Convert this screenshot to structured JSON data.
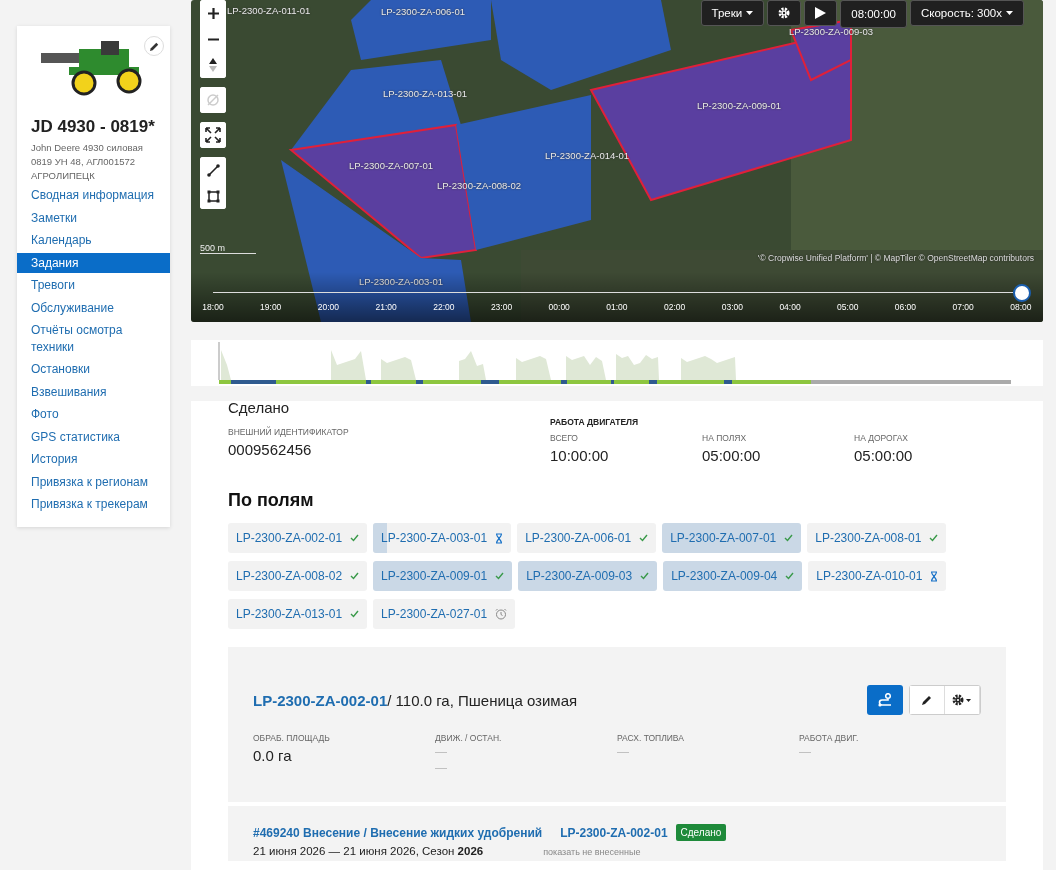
{
  "vehicle": {
    "name": "JD 4930 - 0819*",
    "description": "John Deere 4930 силовая 0819 УН 48, АГЛ001572 АГРОЛИПЕЦК"
  },
  "sidebar": {
    "items": [
      {
        "label": "Сводная информация",
        "selected": false
      },
      {
        "label": "Заметки",
        "selected": false
      },
      {
        "label": "Календарь",
        "selected": false
      },
      {
        "label": "Задания",
        "selected": true
      },
      {
        "label": "Тревоги",
        "selected": false
      },
      {
        "label": "Обслуживание",
        "selected": false
      },
      {
        "label": "Отчёты осмотра техники",
        "selected": false
      },
      {
        "label": "Остановки",
        "selected": false
      },
      {
        "label": "Взвешивания",
        "selected": false
      },
      {
        "label": "Фото",
        "selected": false
      },
      {
        "label": "GPS статистика",
        "selected": false
      },
      {
        "label": "История",
        "selected": false
      },
      {
        "label": "Привязка к регионам",
        "selected": false
      },
      {
        "label": "Привязка к трекерам",
        "selected": false
      }
    ]
  },
  "map": {
    "toolbar": {
      "tracks": "Треки",
      "time": "08:00:00",
      "speed": "Скорость: 300x"
    },
    "field_labels": [
      {
        "text": "LP-2300-ZA-011-01"
      },
      {
        "text": "LP-2300-ZA-006-01"
      },
      {
        "text": "LP-2300-ZA-009-03"
      },
      {
        "text": "LP-2300-ZA-013-01"
      },
      {
        "text": "LP-2300-ZA-009-01"
      },
      {
        "text": "LP-2300-ZA-014-01"
      },
      {
        "text": "LP-2300-ZA-007-01"
      },
      {
        "text": "LP-2300-ZA-008-02"
      },
      {
        "text": "LP-2300-ZA-003-01"
      }
    ],
    "scale": "500 m",
    "attribution": "'© Cropwise Unified Platform' | © MapTiler © OpenStreetMap contributors",
    "timeline": {
      "level": 1,
      "ticks": [
        "18:00",
        "19:00",
        "20:00",
        "21:00",
        "22:00",
        "23:00",
        "00:00",
        "01:00",
        "02:00",
        "03:00",
        "04:00",
        "05:00",
        "06:00",
        "07:00",
        "08:00"
      ]
    }
  },
  "summary": {
    "status": "Сделано",
    "external_id_label": "ВНЕШНИЙ ИДЕНТИФИКАТОР",
    "external_id": "0009562456",
    "engine_title": "РАБОТА ДВИГАТЕЛЯ",
    "engine": [
      {
        "label": "ВСЕГО",
        "value": "10:00:00"
      },
      {
        "label": "НА ПОЛЯХ",
        "value": "05:00:00"
      },
      {
        "label": "НА ДОРОГАХ",
        "value": "05:00:00"
      }
    ]
  },
  "fields": {
    "title": "По полям",
    "chips": [
      {
        "label": "LP-2300-ZA-002-01",
        "kind": "done",
        "highlighted": false
      },
      {
        "label": "LP-2300-ZA-003-01",
        "kind": "pending",
        "highlighted": false,
        "level": 0.1
      },
      {
        "label": "LP-2300-ZA-006-01",
        "kind": "done",
        "highlighted": false
      },
      {
        "label": "LP-2300-ZA-007-01",
        "kind": "done",
        "highlighted": true
      },
      {
        "label": "LP-2300-ZA-008-01",
        "kind": "done",
        "highlighted": false
      },
      {
        "label": "LP-2300-ZA-008-02",
        "kind": "done",
        "highlighted": false
      },
      {
        "label": "LP-2300-ZA-009-01",
        "kind": "done",
        "highlighted": true
      },
      {
        "label": "LP-2300-ZA-009-03",
        "kind": "done",
        "highlighted": true
      },
      {
        "label": "LP-2300-ZA-009-04",
        "kind": "done",
        "highlighted": true
      },
      {
        "label": "LP-2300-ZA-010-01",
        "kind": "pending",
        "highlighted": false
      },
      {
        "label": "LP-2300-ZA-013-01",
        "kind": "done",
        "highlighted": false
      },
      {
        "label": "LP-2300-ZA-027-01",
        "kind": "scheduled",
        "highlighted": false
      }
    ]
  },
  "field_card": {
    "field": "LP-2300-ZA-002-01",
    "details": "/ 110.0 га, Пшеница озимая",
    "stats": [
      {
        "label": "ОБРАБ. ПЛОЩАДЬ",
        "values": [
          "0.0 га"
        ]
      },
      {
        "label": "ДВИЖ. / ОСТАН.",
        "values": [
          "—",
          "—"
        ]
      },
      {
        "label": "РАСХ. ТОПЛИВА",
        "values": [
          "—"
        ]
      },
      {
        "label": "РАБОТА ДВИГ.",
        "values": [
          "—"
        ]
      }
    ]
  },
  "task": {
    "title": "#469240 Внесение / Внесение жидких удобрений",
    "field": "LP-2300-ZA-002-01",
    "badge": "Сделано",
    "dates": "21 июня 2026 — 21 июня 2026, Сезон **2026**",
    "link": "показать не внесенные"
  }
}
